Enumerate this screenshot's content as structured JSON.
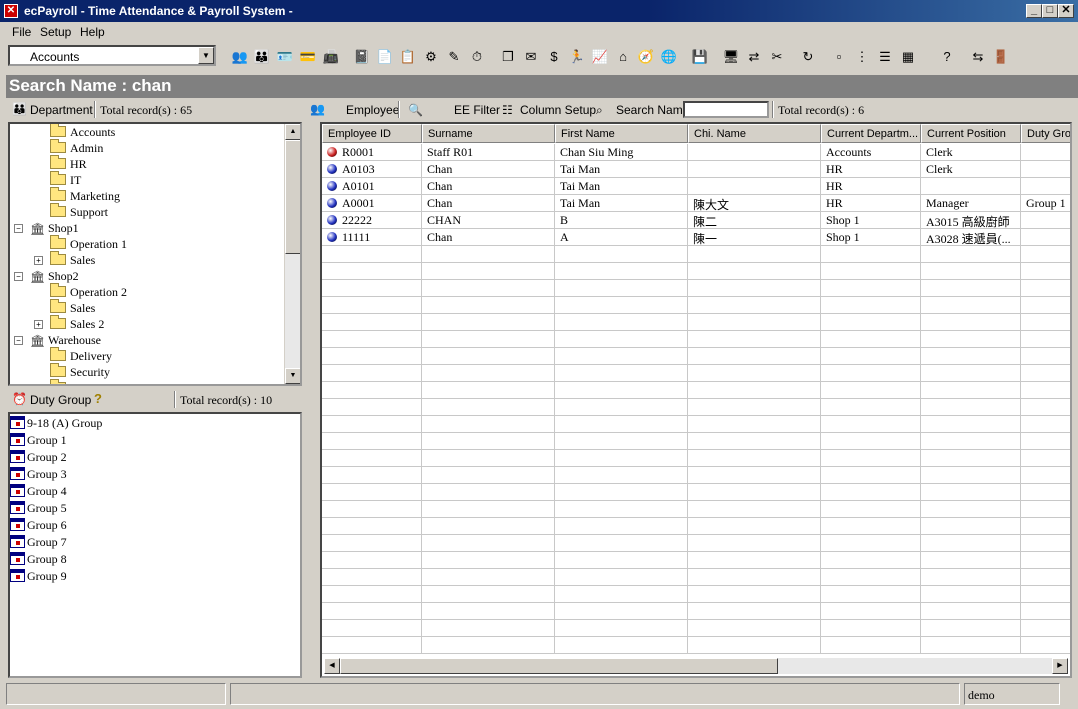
{
  "window": {
    "title": "ecPayroll - Time Attendance & Payroll System -",
    "app_icon": "ec-icon"
  },
  "menu": [
    "File",
    "Setup",
    "Help"
  ],
  "toolbar": {
    "department_combo": "Accounts"
  },
  "search_banner": "Search Name : chan",
  "department_panel": {
    "label": "Department",
    "total": "Total record(s) : 65"
  },
  "tree": [
    {
      "label": "Accounts",
      "level": 2,
      "type": "folder"
    },
    {
      "label": "Admin",
      "level": 2,
      "type": "folder"
    },
    {
      "label": "HR",
      "level": 2,
      "type": "folder"
    },
    {
      "label": "IT",
      "level": 2,
      "type": "folder"
    },
    {
      "label": "Marketing",
      "level": 2,
      "type": "folder"
    },
    {
      "label": "Support",
      "level": 2,
      "type": "folder"
    },
    {
      "label": "Shop1",
      "level": 1,
      "type": "building",
      "expander": "−"
    },
    {
      "label": "Operation 1",
      "level": 2,
      "type": "folder"
    },
    {
      "label": "Sales",
      "level": 2,
      "type": "folder",
      "expander": "+"
    },
    {
      "label": "Shop2",
      "level": 1,
      "type": "building",
      "expander": "−"
    },
    {
      "label": "Operation 2",
      "level": 2,
      "type": "folder"
    },
    {
      "label": "Sales",
      "level": 2,
      "type": "folder"
    },
    {
      "label": "Sales 2",
      "level": 2,
      "type": "folder",
      "expander": "+"
    },
    {
      "label": "Warehouse",
      "level": 1,
      "type": "building",
      "expander": "−"
    },
    {
      "label": "Delivery",
      "level": 2,
      "type": "folder"
    },
    {
      "label": "Security",
      "level": 2,
      "type": "folder"
    },
    {
      "label": "W.H. Operation",
      "level": 2,
      "type": "folder"
    }
  ],
  "duty_panel": {
    "label": "Duty Group",
    "total": "Total record(s) : 10"
  },
  "duty_groups": [
    "9-18 (A) Group",
    "Group 1",
    "Group 2",
    "Group 3",
    "Group 4",
    "Group 5",
    "Group 6",
    "Group 7",
    "Group 8",
    "Group 9"
  ],
  "employee_panel": {
    "label": "Employee",
    "ee_filter": "EE Filter",
    "column_setup": "Column Setup",
    "search_name_label": "Search Name",
    "search_value": "",
    "total": "Total record(s) : 6"
  },
  "columns": [
    "Employee ID",
    "Surname",
    "First Name",
    "Chi. Name",
    "Current Departm...",
    "Current Position",
    "Duty Group"
  ],
  "rows": [
    {
      "status": "red",
      "cells": [
        "R0001",
        "Staff R01",
        "Chan Siu Ming",
        "",
        "Accounts",
        "Clerk",
        ""
      ]
    },
    {
      "status": "blue",
      "cells": [
        "A0103",
        "Chan",
        "Tai Man",
        "",
        "HR",
        "Clerk",
        ""
      ]
    },
    {
      "status": "blue",
      "cells": [
        "A0101",
        "Chan",
        "Tai Man",
        "",
        "HR",
        "",
        ""
      ]
    },
    {
      "status": "blue",
      "cells": [
        "A0001",
        "Chan",
        "Tai Man",
        "陳大文",
        "HR",
        "Manager",
        "Group 1"
      ]
    },
    {
      "status": "blue",
      "cells": [
        "22222",
        "CHAN",
        "B",
        "陳二",
        "Shop 1",
        "A3015 高級廚師",
        ""
      ]
    },
    {
      "status": "blue",
      "cells": [
        "11111",
        "Chan",
        "A",
        "陳一",
        "Shop 1",
        "A3028 速遞員(...",
        ""
      ]
    }
  ],
  "colors": {
    "red_status": "#cc2020",
    "blue_status": "#2030c0",
    "title_bar": "#0a246a"
  },
  "statusbar": {
    "user": "demo"
  }
}
